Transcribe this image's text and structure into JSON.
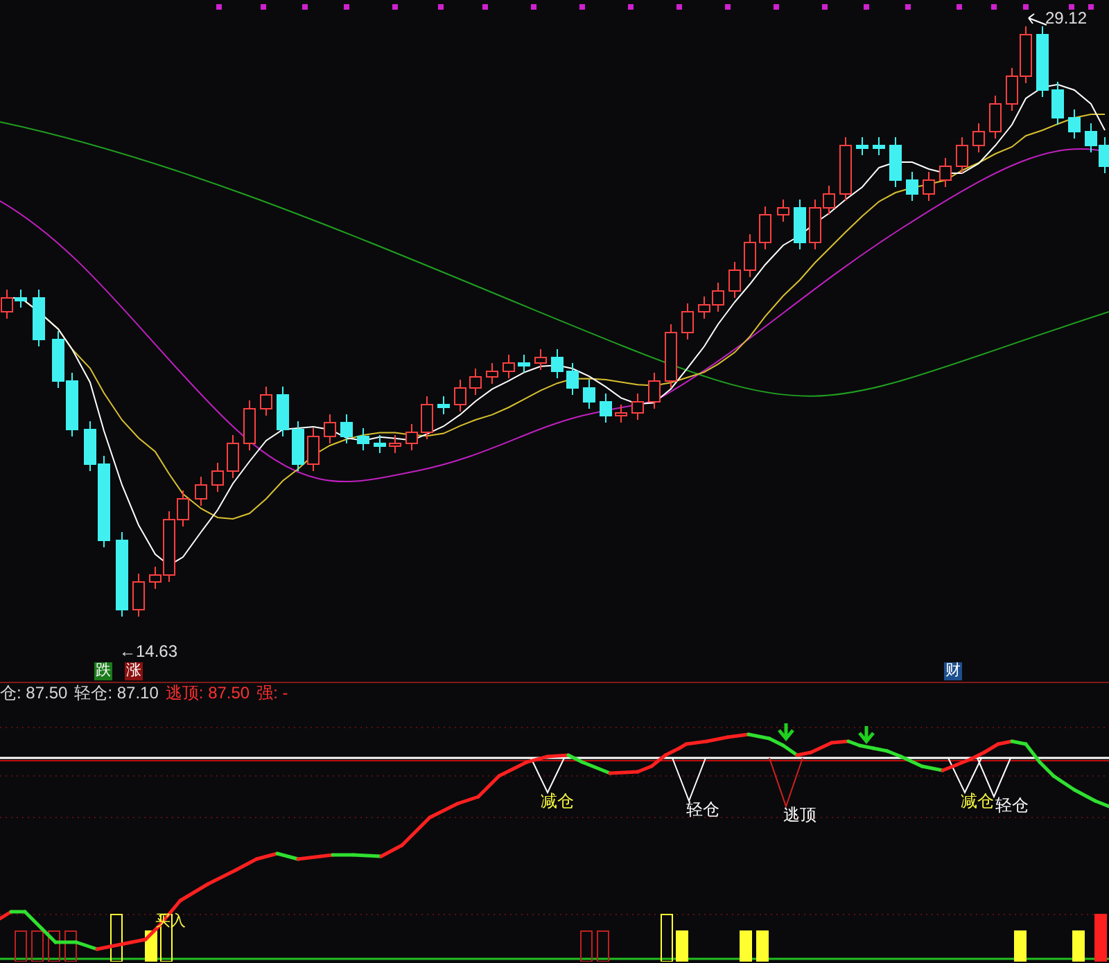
{
  "price_chart": {
    "high_label": "29.12",
    "low_label": "←14.63",
    "markers": [
      {
        "text": "跌",
        "kind": "down"
      },
      {
        "text": "涨",
        "kind": "up"
      },
      {
        "text": "财",
        "kind": "finance"
      }
    ]
  },
  "indicator": {
    "legend": [
      {
        "text": "仓: 87.50",
        "kind": "neutral"
      },
      {
        "text": "轻仓: 87.10",
        "kind": "neutral"
      },
      {
        "text": "逃顶: 87.50",
        "kind": "alert"
      },
      {
        "text": "强: -",
        "kind": "alert"
      }
    ],
    "signals": [
      {
        "text": "减仓",
        "kind": "reduce"
      },
      {
        "text": "轻仓",
        "kind": "light"
      },
      {
        "text": "逃顶",
        "kind": "escape"
      },
      {
        "text": "减仓",
        "kind": "reduce"
      },
      {
        "text": "轻仓",
        "kind": "light"
      }
    ],
    "buy_label": "买入"
  }
}
